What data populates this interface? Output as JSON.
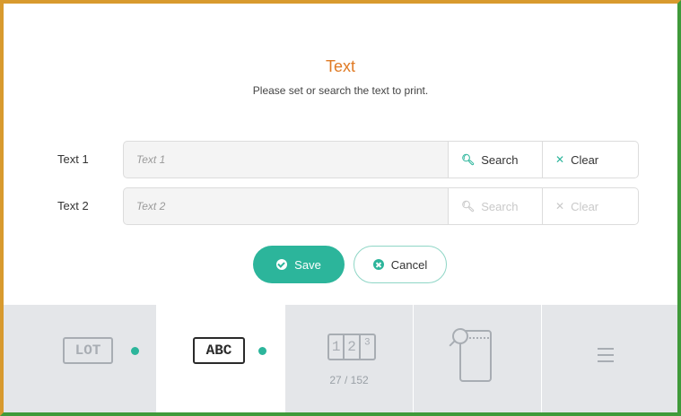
{
  "dialog": {
    "title": "Text",
    "subtitle": "Please set or search the text to print."
  },
  "fields": [
    {
      "label": "Text 1",
      "placeholder": "Text 1",
      "value": "",
      "search_label": "Search",
      "clear_label": "Clear",
      "enabled": true
    },
    {
      "label": "Text 2",
      "placeholder": "Text 2",
      "value": "",
      "search_label": "Search",
      "clear_label": "Clear",
      "enabled": false
    }
  ],
  "actions": {
    "save_label": "Save",
    "cancel_label": "Cancel"
  },
  "toolbar": {
    "tabs": [
      {
        "id": "lot",
        "icon_text": "LOT",
        "has_dot": true
      },
      {
        "id": "abc",
        "icon_text": "ABC",
        "has_dot": true,
        "active": true
      },
      {
        "id": "counter",
        "icon_digits": [
          "1",
          "2",
          "3"
        ],
        "counter": "27 / 152"
      },
      {
        "id": "search-label",
        "icon": "phone-search-icon"
      },
      {
        "id": "menu",
        "icon": "menu-icon"
      }
    ]
  },
  "colors": {
    "accent": "#2cb59b",
    "title": "#e07a24",
    "toolbar_bg": "#e4e6e9"
  }
}
